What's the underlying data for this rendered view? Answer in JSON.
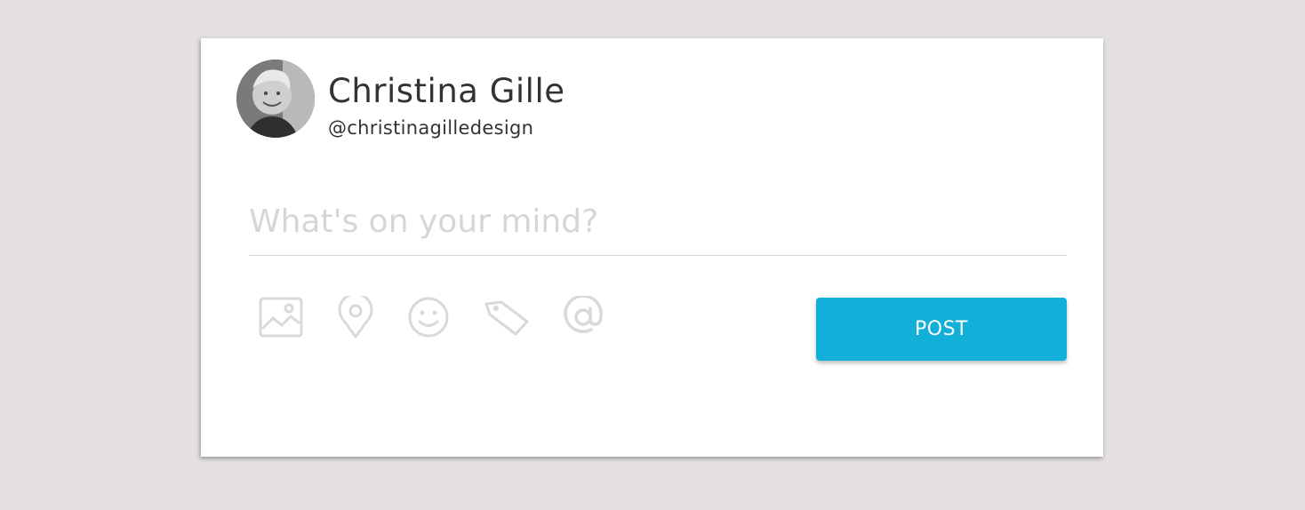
{
  "profile": {
    "name": "Christina Gille",
    "handle": "@christinagilledesign"
  },
  "composer": {
    "placeholder": "What's on your mind?",
    "value": ""
  },
  "toolbar": {
    "icons": [
      "image-icon",
      "location-pin-icon",
      "smiley-icon",
      "tag-icon",
      "mention-icon"
    ],
    "post_label": "POST"
  },
  "colors": {
    "background": "#e4e1e0",
    "card": "#ffffff",
    "accent": "#12afd8",
    "icon": "#d9d9d9",
    "text": "#333333",
    "placeholder": "#d6d6d6"
  }
}
